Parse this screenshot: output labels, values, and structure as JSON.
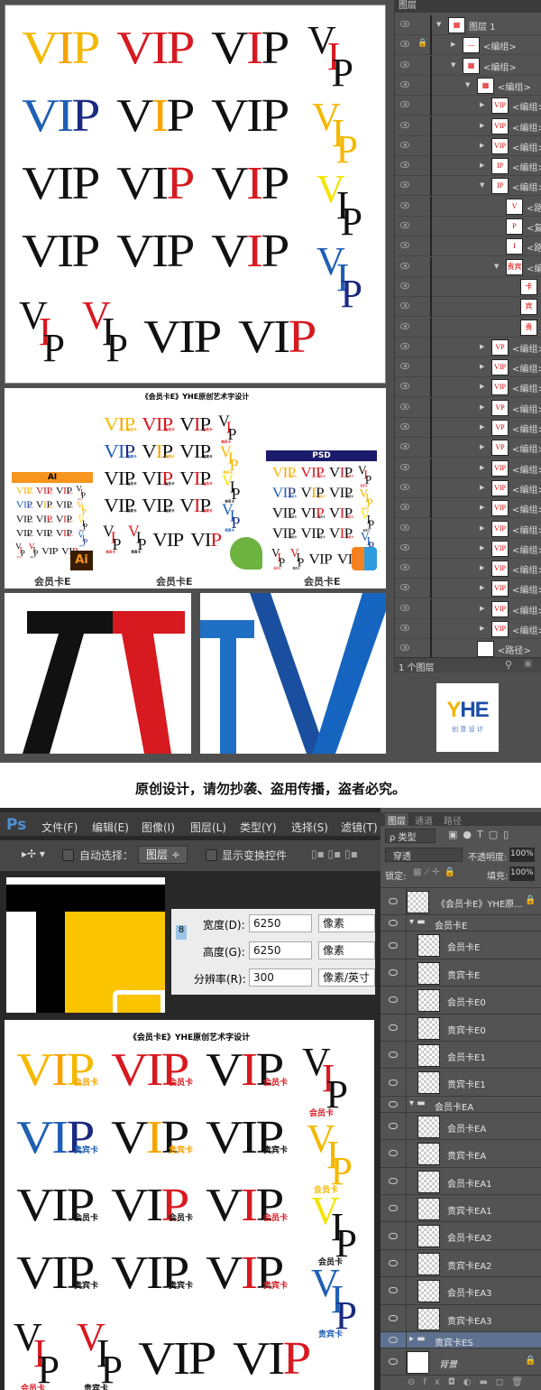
{
  "ai_layers_panel": {
    "tab": "图层",
    "footer": "1 个图层",
    "rows": [
      {
        "label": "图层 1",
        "indent": 0,
        "arrow": "down",
        "thumb": "▦"
      },
      {
        "label": "<编组>",
        "indent": 1,
        "arrow": "right",
        "lock": true,
        "thumb": "—"
      },
      {
        "label": "<编组>",
        "indent": 1,
        "arrow": "down",
        "thumb": "▦"
      },
      {
        "label": "<编组>",
        "indent": 2,
        "arrow": "down",
        "thumb": "▦"
      },
      {
        "label": "<编组>",
        "indent": 3,
        "arrow": "right",
        "thumb": "VIP"
      },
      {
        "label": "<编组>",
        "indent": 3,
        "arrow": "right",
        "thumb": "VIP"
      },
      {
        "label": "<编组>",
        "indent": 3,
        "arrow": "right",
        "thumb": "VIP"
      },
      {
        "label": "<编组>",
        "indent": 3,
        "arrow": "right",
        "thumb": "IP"
      },
      {
        "label": "<编组>",
        "indent": 3,
        "arrow": "down",
        "thumb": "IP"
      },
      {
        "label": "<路...",
        "indent": 4,
        "arrow": "",
        "thumb": "V"
      },
      {
        "label": "<复...",
        "indent": 4,
        "arrow": "",
        "thumb": "P"
      },
      {
        "label": "<路...",
        "indent": 4,
        "arrow": "",
        "thumb": "I"
      },
      {
        "label": "<编...",
        "indent": 4,
        "arrow": "down",
        "thumb": "贵宾卡"
      },
      {
        "label": "",
        "indent": 5,
        "arrow": "",
        "thumb": "卡"
      },
      {
        "label": "",
        "indent": 5,
        "arrow": "",
        "thumb": "宾"
      },
      {
        "label": "",
        "indent": 5,
        "arrow": "",
        "thumb": "贵"
      },
      {
        "label": "<编组>",
        "indent": 3,
        "arrow": "right",
        "thumb": "VP"
      },
      {
        "label": "<编组>",
        "indent": 3,
        "arrow": "right",
        "thumb": "VIP"
      },
      {
        "label": "<编组>",
        "indent": 3,
        "arrow": "right",
        "thumb": "VIP"
      },
      {
        "label": "<编组>",
        "indent": 3,
        "arrow": "right",
        "thumb": "VP"
      },
      {
        "label": "<编组>",
        "indent": 3,
        "arrow": "right",
        "thumb": "VP"
      },
      {
        "label": "<编组>",
        "indent": 3,
        "arrow": "right",
        "thumb": "VP"
      },
      {
        "label": "<编组>",
        "indent": 3,
        "arrow": "right",
        "thumb": "VIP"
      },
      {
        "label": "<编组>",
        "indent": 3,
        "arrow": "right",
        "thumb": "VIP"
      },
      {
        "label": "<编组>",
        "indent": 3,
        "arrow": "right",
        "thumb": "VIP"
      },
      {
        "label": "<编组>",
        "indent": 3,
        "arrow": "right",
        "thumb": "VIP"
      },
      {
        "label": "<编组>",
        "indent": 3,
        "arrow": "right",
        "thumb": "VIP"
      },
      {
        "label": "<编组>",
        "indent": 3,
        "arrow": "right",
        "thumb": "VIP"
      },
      {
        "label": "<编组>",
        "indent": 3,
        "arrow": "right",
        "thumb": "VIP"
      },
      {
        "label": "<编组>",
        "indent": 3,
        "arrow": "right",
        "thumb": "VIP"
      },
      {
        "label": "<编组>",
        "indent": 3,
        "arrow": "right",
        "thumb": "VIP"
      },
      {
        "label": "<路径>",
        "indent": 2,
        "arrow": "",
        "thumb": ""
      }
    ]
  },
  "logo": {
    "text": "YHE",
    "sub": "创 意 设 计",
    "colors": [
      "#f0b400",
      "#1d4fa8"
    ]
  },
  "preview": {
    "title": "《会员卡E》YHE原创艺术字设计",
    "ai_bar": "AI",
    "psd_bar": "PSD",
    "ai_icon": "Ai",
    "captions": [
      "会员卡E",
      "会员卡E",
      "会员卡E"
    ],
    "colors": {
      "ai": "#f7941d",
      "psd": "#1b1b6b",
      "corel": "#6cb33f"
    }
  },
  "notice": "原创设计，请勿抄袭、盗用传播，盗者必究。",
  "ps": {
    "logo": "Ps",
    "menu": [
      "文件(F)",
      "编辑(E)",
      "图像(I)",
      "图层(L)",
      "类型(Y)",
      "选择(S)",
      "滤镜(T)"
    ],
    "toolbar": {
      "auto_select": "自动选择：",
      "auto_select_value": "图层",
      "show_transform": "显示变换控件"
    },
    "dialog": {
      "width_label": "宽度(D):",
      "width": "6250",
      "height_label": "高度(G):",
      "height": "6250",
      "res_label": "分辨率(R):",
      "res": "300",
      "unit": "像素",
      "res_unit": "像素/英寸"
    }
  },
  "artboard": {
    "title": "《会员卡E》YHE原创艺术字设计",
    "marks": [
      {
        "text": "VIP",
        "colors": [
          "#f5b800",
          "#f5a300",
          "#f5b800"
        ],
        "label": "会员卡",
        "stack": false
      },
      {
        "text": "VIP",
        "colors": [
          "#d71920",
          "#d71920",
          "#d71920"
        ],
        "label": "会员卡",
        "stack": false
      },
      {
        "text": "VIP",
        "colors": [
          "#111",
          "#d71920",
          "#111"
        ],
        "label": "会员卡",
        "stack": false
      },
      {
        "text": "VIP",
        "colors": [
          "#111",
          "#d71920",
          "#111"
        ],
        "label": "会员卡",
        "stack": true
      },
      {
        "text": "VIP",
        "colors": [
          "#1f5fb4",
          "#1f5fb4",
          "#1a2a80"
        ],
        "label": "贵宾卡",
        "stack": false
      },
      {
        "text": "VIP",
        "colors": [
          "#111",
          "#f5a300",
          "#111"
        ],
        "label": "贵宾卡",
        "stack": false
      },
      {
        "text": "VIP",
        "colors": [
          "#111",
          "#111",
          "#111"
        ],
        "label": "贵宾卡",
        "stack": false
      },
      {
        "text": "VIP",
        "colors": [
          "#f5b800",
          "#f5b800",
          "#f5b800"
        ],
        "label": "会员卡",
        "stack": true
      },
      {
        "text": "VIP",
        "colors": [
          "#111",
          "#111",
          "#111"
        ],
        "label": "会员卡",
        "stack": false
      },
      {
        "text": "VIP",
        "colors": [
          "#111",
          "#111",
          "#d71920"
        ],
        "label": "会员卡",
        "stack": false
      },
      {
        "text": "VIP",
        "colors": [
          "#111",
          "#d71920",
          "#111"
        ],
        "label": "会员卡",
        "stack": false
      },
      {
        "text": "VIP",
        "colors": [
          "#f2e400",
          "#111",
          "#111"
        ],
        "label": "会员卡",
        "stack": true
      },
      {
        "text": "VIP",
        "colors": [
          "#111",
          "#111",
          "#111"
        ],
        "label": "贵宾卡",
        "stack": false
      },
      {
        "text": "VIP",
        "colors": [
          "#111",
          "#111",
          "#111"
        ],
        "label": "贵宾卡",
        "stack": false
      },
      {
        "text": "VIP",
        "colors": [
          "#111",
          "#d71920",
          "#111"
        ],
        "label": "贵宾卡",
        "stack": false
      },
      {
        "text": "VIP",
        "colors": [
          "#1f5fb4",
          "#1f5fb4",
          "#1a2a80"
        ],
        "label": "贵宾卡",
        "stack": true
      },
      {
        "text": "VIP",
        "colors": [
          "#111",
          "#d71920",
          "#111"
        ],
        "label": "会员卡",
        "stack": true
      },
      {
        "text": "VIP",
        "colors": [
          "#d71920",
          "#111",
          "#111"
        ],
        "label": "贵宾卡",
        "stack": true
      },
      {
        "text": "VIP",
        "colors": [
          "#111",
          "#111",
          "#111"
        ],
        "label": "",
        "stack": false
      },
      {
        "text": "VIP",
        "colors": [
          "#111",
          "#111",
          "#d71920"
        ],
        "label": "",
        "stack": false
      }
    ]
  },
  "ps_layers": {
    "tabs": [
      "图层",
      "通道",
      "路径"
    ],
    "filter": "ρ 类型",
    "blend": "穿透",
    "opacity_label": "不透明度:",
    "opacity": "100%",
    "lock_label": "锁定:",
    "fill_label": "填充:",
    "fill": "100%",
    "rows": [
      {
        "type": "layer",
        "label": "《会员卡E》YHE原...",
        "lock": true,
        "indent": 0
      },
      {
        "type": "group",
        "label": "会员卡E"
      },
      {
        "type": "layer",
        "label": "会员卡E",
        "indent": 1
      },
      {
        "type": "layer",
        "label": "贵宾卡E",
        "indent": 1
      },
      {
        "type": "layer",
        "label": "会员卡E0",
        "indent": 1
      },
      {
        "type": "layer",
        "label": "贵宾卡E0",
        "indent": 1
      },
      {
        "type": "layer",
        "label": "会员卡E1",
        "indent": 1
      },
      {
        "type": "layer",
        "label": "贵宾卡E1",
        "indent": 1
      },
      {
        "type": "group",
        "label": "会员卡EA"
      },
      {
        "type": "layer",
        "label": "会员卡EA",
        "indent": 1
      },
      {
        "type": "layer",
        "label": "贵宾卡EA",
        "indent": 1
      },
      {
        "type": "layer",
        "label": "会员卡EA1",
        "indent": 1
      },
      {
        "type": "layer",
        "label": "贵宾卡EA1",
        "indent": 1
      },
      {
        "type": "layer",
        "label": "会员卡EA2",
        "indent": 1
      },
      {
        "type": "layer",
        "label": "贵宾卡EA2",
        "indent": 1
      },
      {
        "type": "layer",
        "label": "会员卡EA3",
        "indent": 1
      },
      {
        "type": "layer",
        "label": "贵宾卡EA3",
        "indent": 1
      },
      {
        "type": "group-closed",
        "label": "贵宾卡ES",
        "selected": true
      },
      {
        "type": "background",
        "label": "背景",
        "lock": true,
        "indent": 0
      }
    ],
    "selected_color": "#5e7190"
  }
}
